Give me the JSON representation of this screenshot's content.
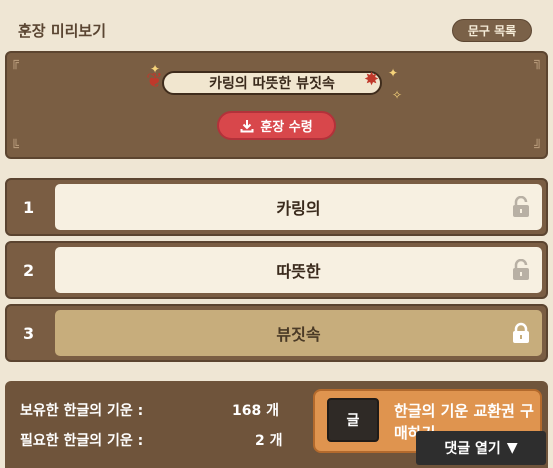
{
  "header": {
    "title": "훈장 미리보기",
    "list_button": "문구 목록"
  },
  "preview": {
    "medal_title": "카링의 따뜻한 뷰짓속",
    "receive_button": "훈장 수령"
  },
  "slots": [
    {
      "number": "1",
      "text": "카링의",
      "state": "unlocked"
    },
    {
      "number": "2",
      "text": "따뜻한",
      "state": "unlocked"
    },
    {
      "number": "3",
      "text": "뷰짓속",
      "state": "locked"
    }
  ],
  "stats": {
    "owned_label": "보유한 한글의 기운 :",
    "owned_value": "168 개",
    "required_label": "필요한 한글의 기운 :",
    "required_value": "2 개"
  },
  "buy": {
    "icon_text": "글",
    "label": "한글의 기운 교환권 구매하기"
  },
  "comments": {
    "label": "댓글 열기",
    "icon": "caret-down-icon"
  },
  "colors": {
    "panel_brown": "#7a5e43",
    "accent_red": "#d8474b",
    "buy_orange": "#df944f"
  }
}
